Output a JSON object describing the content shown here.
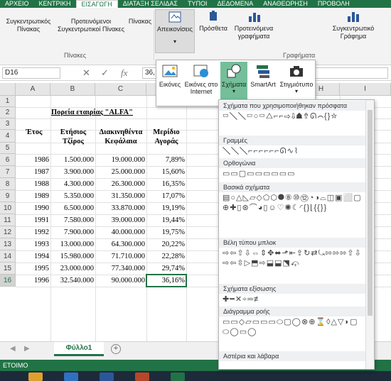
{
  "ribbon": {
    "tabs": [
      "ΑΡΧΕΙΟ",
      "ΚΕΝΤΡΙΚΗ",
      "ΕΙΣΑΓΩΓΗ",
      "ΔΙΑΤΑΞΗ ΣΕΛΙΔΑΣ",
      "ΤΥΠΟΙ",
      "ΔΕΔΟΜΕΝΑ",
      "ΑΝΑΘΕΩΡΗΣΗ",
      "ΠΡΟΒΟΛΗ"
    ],
    "active_tab": "ΕΙΣΑΓΩΓΗ",
    "buttons": {
      "pivot": "Συγκεντρωτικός Πίνακας",
      "recommended_pivot": "Προτεινόμενοι Συγκεντρωτικοί Πίνακες",
      "table": "Πίνακας",
      "illustrations": "Απεικονίσεις",
      "addins": "Πρόσθετα",
      "recommended_charts": "Προτεινόμενα γραφήματα",
      "pivot_chart": "Συγκεντρωτικό Γράφημα"
    },
    "groups": {
      "tables": "Πίνακες",
      "charts": "Γραφήματα"
    }
  },
  "formula_bar": {
    "name_box": "D16",
    "formula_value": "36,"
  },
  "illustrations_menu": {
    "pictures": "Εικόνες",
    "online_pictures": "Εικόνες στο Internet",
    "shapes": "Σχήματα",
    "smartart": "SmartArt",
    "screenshot": "Στιγμιότυπο"
  },
  "shapes_panel": {
    "sections": [
      {
        "title": "Σχήματα που χρησιμοποιήθηκαν πρόσφατα",
        "glyphs": "▭╲╲▭○▭△⌐⌐⇨⇩☗⇮ᘏ⌒{}☆"
      },
      {
        "title": "Γραμμές",
        "glyphs": "╲╲╲⌐⌐⌐⌐⌐⌐ᘏ∿⌇"
      },
      {
        "title": "Ορθογώνια",
        "glyphs": "▭▭▢▭▭▭▭▭▭"
      },
      {
        "title": "Βασικά σχήματα",
        "glyphs": "▤○△◺▱◇⬠⬡⯃⑧⑩⑫◔◑⌓◫▣⬜▢⊕✚▯⊛⌒◕▯☺♡✺☾◜{}⌊{{}}"
      },
      {
        "title": "Βέλη τύπου μπλοκ",
        "glyphs": "⇨⇦⇧⇩⇔⇕✥⬌⬏⇤⇪↻⇄⤿⇰⇰⇰⇧⇩⇨⇦⇳▷⬒⇨⬓⬓⬔⤽"
      },
      {
        "title": "Σχήματα εξίσωσης",
        "glyphs": "✚━✕÷═≢"
      },
      {
        "title": "Διάγραμμα ροής",
        "glyphs": "▭▭◇▱▭▭▭⬭▢◯⊗⊕⌛◊△▽◗▢⬭◯▭◯"
      },
      {
        "title": "Αστέρια και λάβαρα",
        "glyphs": ""
      }
    ]
  },
  "sheet": {
    "columns": [
      "A",
      "B",
      "C",
      "D",
      "E",
      "F",
      "G",
      "H",
      "I"
    ],
    "rows": [
      "1",
      "2",
      "3",
      "4",
      "5",
      "6",
      "7",
      "8",
      "9",
      "10",
      "11",
      "12",
      "13",
      "14",
      "15",
      "16"
    ],
    "title": "Πορεία εταιρίας \"ALFA\"",
    "headers": {
      "year": "Έτος",
      "turnover_1": "Ετήσιος",
      "turnover_2": "Τζίρος",
      "capital_1": "Διακινηθέντα",
      "capital_2": "Κεφάλαια",
      "share_1": "Μερίδιο",
      "share_2": "Αγοράς"
    },
    "data": [
      [
        "1986",
        "1.500.000",
        "19.000.000",
        "7,89%"
      ],
      [
        "1987",
        "3.900.000",
        "25.000.000",
        "15,60%"
      ],
      [
        "1988",
        "4.300.000",
        "26.300.000",
        "16,35%"
      ],
      [
        "1989",
        "5.350.000",
        "31.350.000",
        "17,07%"
      ],
      [
        "1990",
        "6.500.000",
        "33.870.000",
        "19,19%"
      ],
      [
        "1991",
        "7.580.000",
        "39.000.000",
        "19,44%"
      ],
      [
        "1992",
        "7.900.000",
        "40.000.000",
        "19,75%"
      ],
      [
        "1993",
        "13.000.000",
        "64.300.000",
        "20,22%"
      ],
      [
        "1994",
        "15.980.000",
        "71.710.000",
        "22,28%"
      ],
      [
        "1995",
        "23.000.000",
        "77.340.000",
        "29,74%"
      ],
      [
        "1996",
        "32.540.000",
        "90.000.000",
        "36,16%"
      ]
    ],
    "sheet_tab": "Φύλλο1",
    "add_sheet": "+"
  },
  "status_bar": {
    "text": "ΕΤΟΙΜΟ"
  },
  "colors": {
    "accent": "#217346",
    "selected_menu": "#74bf9a"
  }
}
